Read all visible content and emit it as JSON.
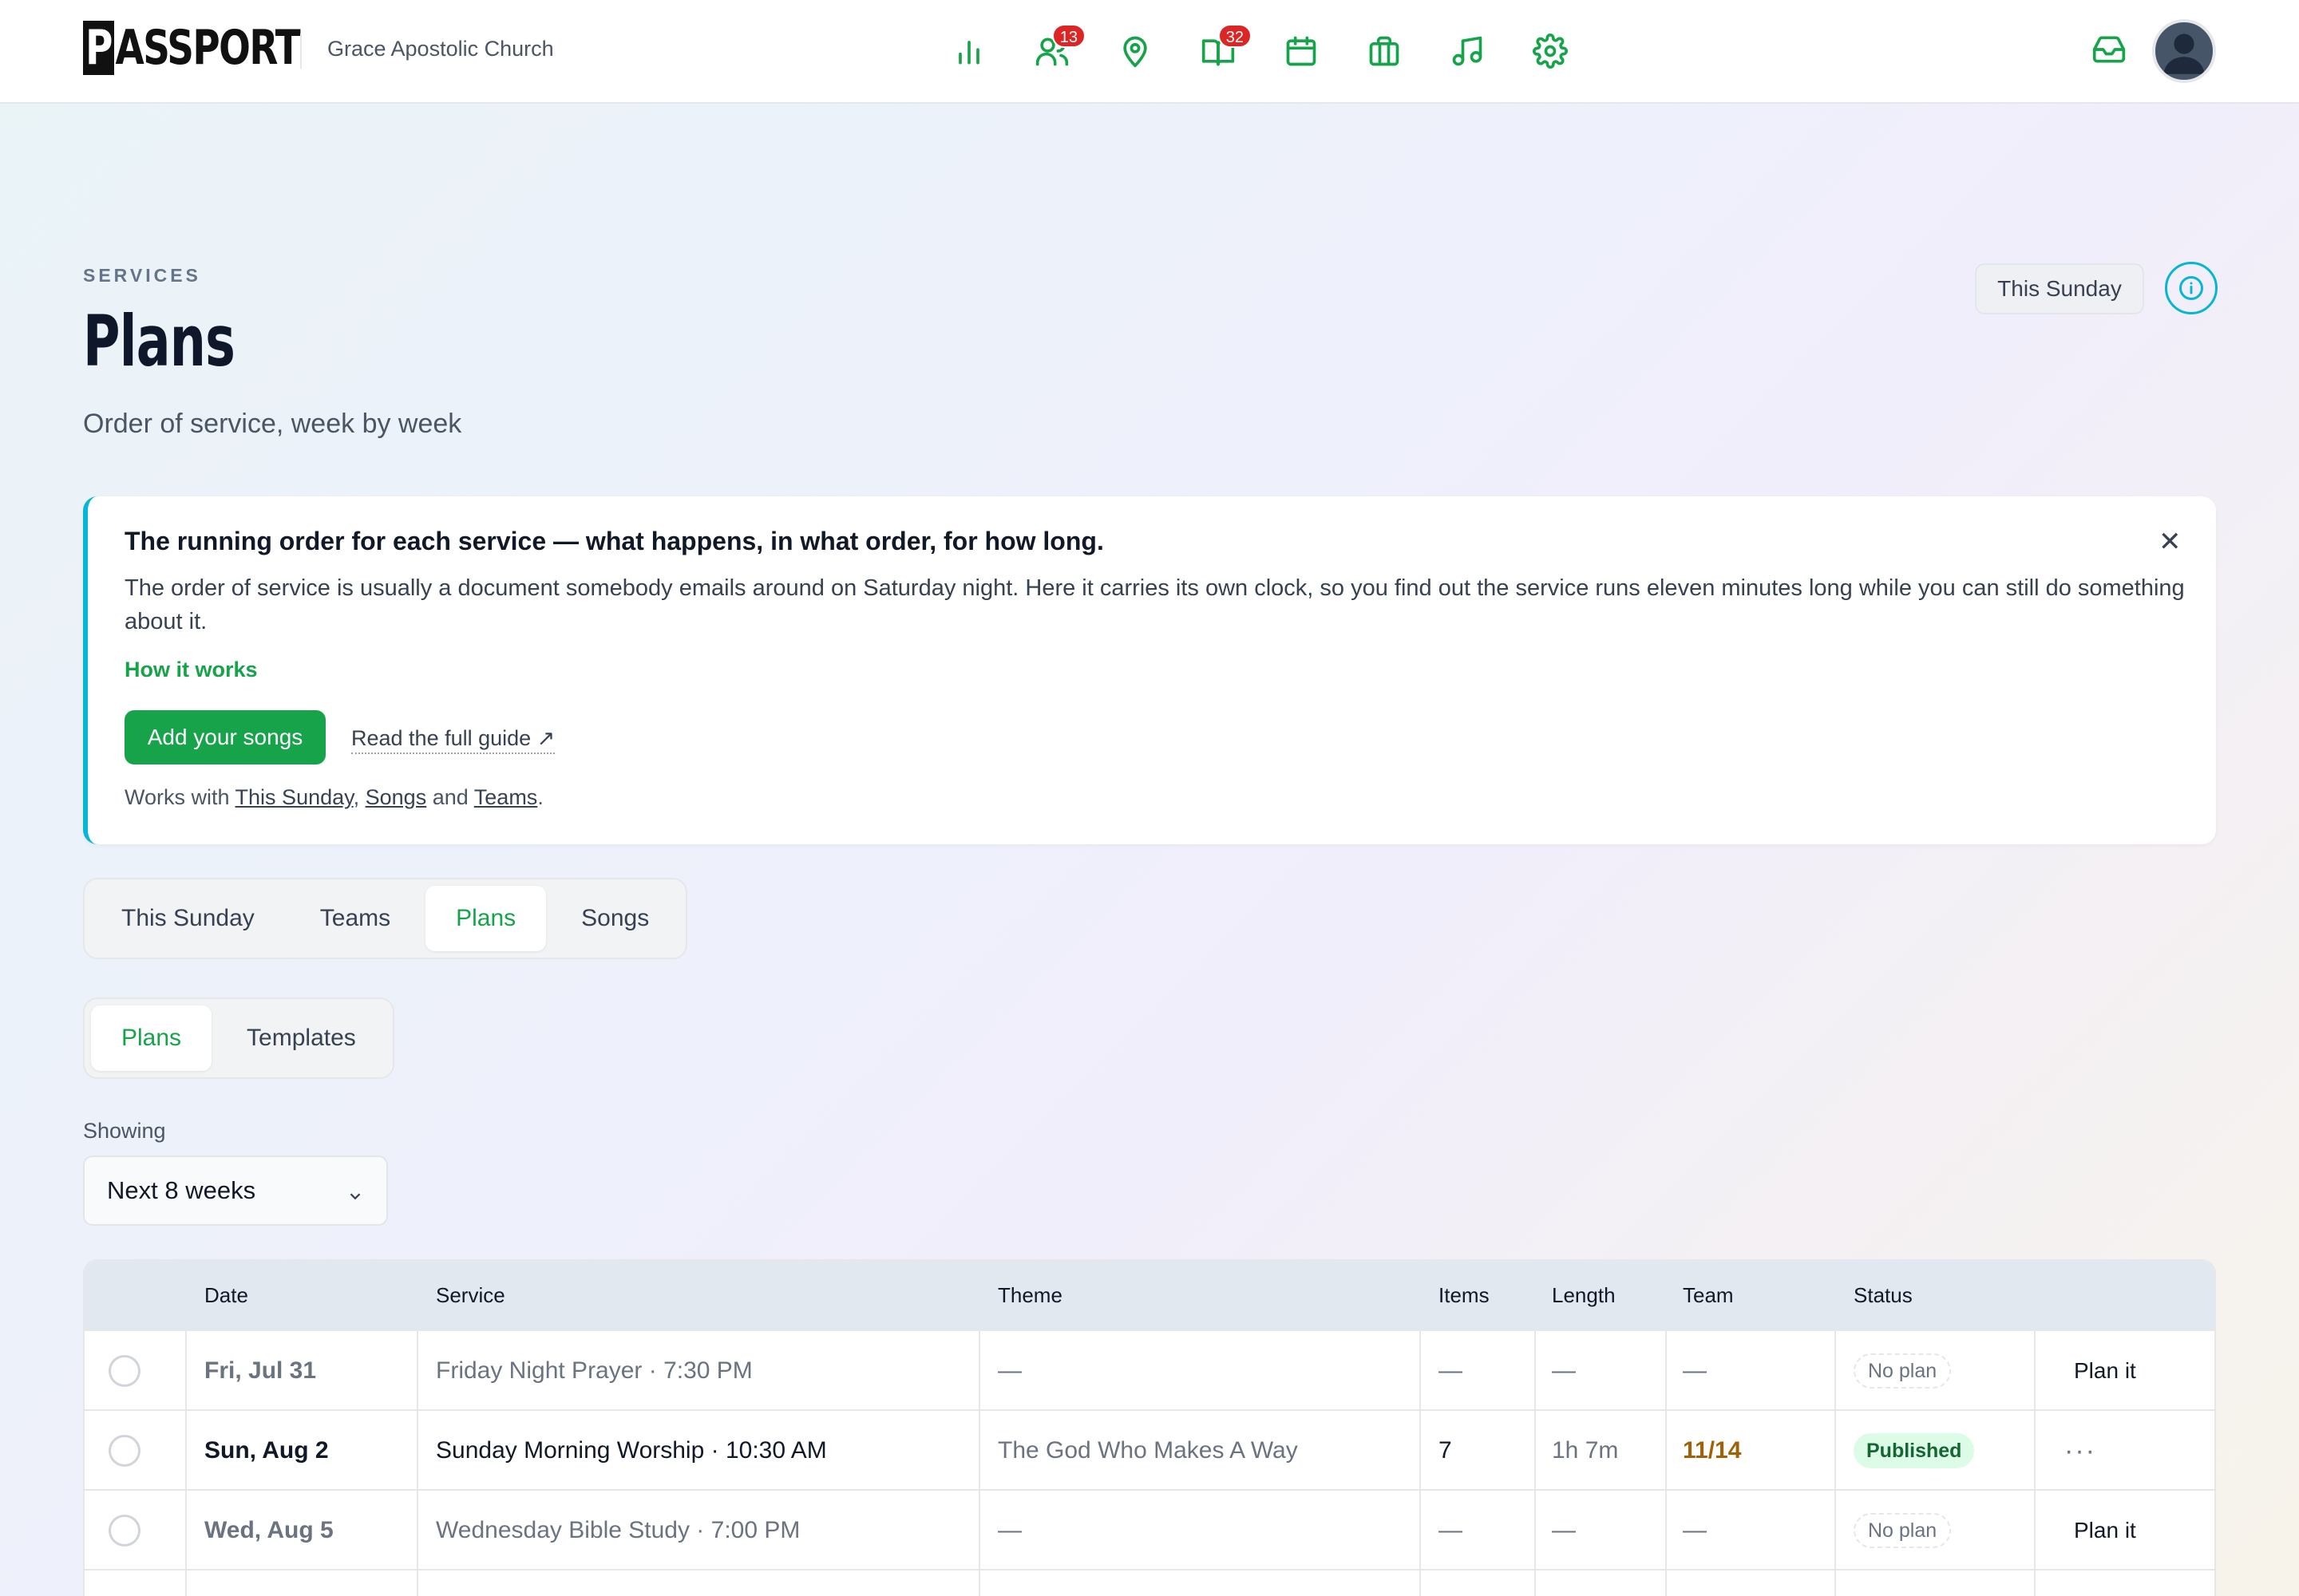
{
  "app": {
    "logo_text": "PASSPORT",
    "org_name": "Grace Apostolic Church",
    "nav": [
      {
        "icon": "bar-chart-icon"
      },
      {
        "icon": "people-icon",
        "badge": "13"
      },
      {
        "icon": "map-pin-icon"
      },
      {
        "icon": "book-open-icon",
        "badge": "32"
      },
      {
        "icon": "calendar-icon"
      },
      {
        "icon": "briefcase-icon"
      },
      {
        "icon": "music-note-icon"
      },
      {
        "icon": "gear-icon"
      }
    ],
    "inbox_icon": "inbox-icon",
    "avatar_icon": "user-avatar-icon",
    "accent_color": "#16a34a",
    "info_color": "#06b6d4"
  },
  "header": {
    "eyebrow": "SERVICES",
    "title": "Plans",
    "subtitle": "Order of service, week by week",
    "this_sunday_button": "This Sunday",
    "info_icon": "info-icon"
  },
  "callout": {
    "title": "The running order for each service — what happens, in what order, for how long.",
    "body": "The order of service is usually a document somebody emails around on Saturday night. Here it carries its own clock, so you find out the service runs eleven minutes long while you can still do something about it.",
    "how_link": "How it works",
    "primary_button": "Add your songs",
    "guide_link": "Read the full guide ↗",
    "works_prefix": "Works with ",
    "works_links": [
      "This Sunday",
      "Songs",
      "Teams"
    ],
    "works_sep1": ", ",
    "works_sep2": " and ",
    "works_suffix": ".",
    "close_icon": "close-icon"
  },
  "tabs": [
    "This Sunday",
    "Teams",
    "Plans",
    "Songs"
  ],
  "active_tab": "Plans",
  "subtabs": [
    "Plans",
    "Templates"
  ],
  "active_subtab": "Plans",
  "filter": {
    "label": "Showing",
    "value": "Next 8 weeks"
  },
  "table": {
    "columns": [
      "Date",
      "Service",
      "Theme",
      "Items",
      "Length",
      "Team",
      "Status"
    ],
    "rows": [
      {
        "date": "Fri, Jul 31",
        "service": "Friday Night Prayer · 7:30 PM",
        "theme": "—",
        "items": "—",
        "length": "—",
        "team": "—",
        "status": "No plan",
        "action": "Plan it"
      },
      {
        "date": "Sun, Aug 2",
        "service": "Sunday Morning Worship · 10:30 AM",
        "theme": "The God Who Makes A Way",
        "items": "7",
        "length": "1h 7m",
        "team": "11/14",
        "status": "Published",
        "action": "···"
      },
      {
        "date": "Wed, Aug 5",
        "service": "Wednesday Bible Study · 7:00 PM",
        "theme": "—",
        "items": "—",
        "length": "—",
        "team": "—",
        "status": "No plan",
        "action": "Plan it"
      }
    ]
  }
}
